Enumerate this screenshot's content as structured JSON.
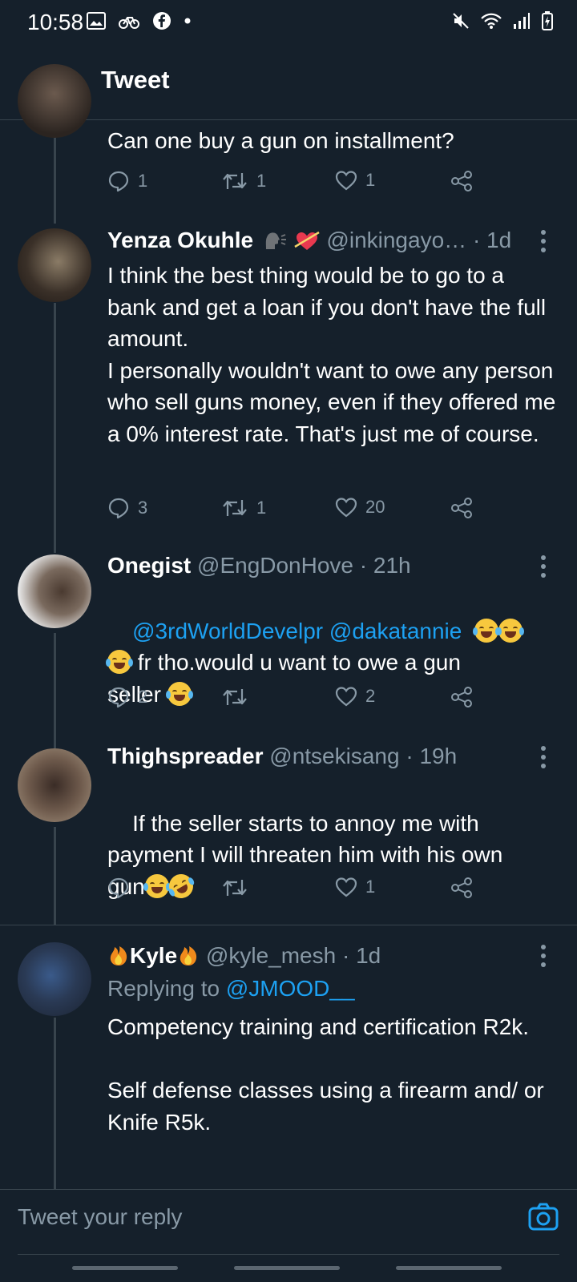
{
  "status_bar": {
    "time": "10:58"
  },
  "header": {
    "title": "Tweet"
  },
  "tweets": [
    {
      "text": "Can one buy a gun on installment?",
      "replies": "1",
      "retweets": "1",
      "likes": "1"
    },
    {
      "name": "Yenza Okuhle",
      "handle": "@inkingayo…",
      "time": "· 1d",
      "text": "I think the best thing would be to go to a bank and get a loan if you don't have the full amount.\nI personally wouldn't want to owe any person who sell guns money, even if they offered me a 0% interest rate. That's just me of course.",
      "replies": "3",
      "retweets": "1",
      "likes": "20"
    },
    {
      "name": "Onegist",
      "handle": "@EngDonHove",
      "time": "· 21h",
      "mention1": "@3rdWorldDevelpr",
      "mention2": "@dakatannie",
      "text_line2": " fr tho.would u want to owe a gun",
      "text_line3": "seller ",
      "replies": "2",
      "retweets": "",
      "likes": "2"
    },
    {
      "name": "Thighspreader",
      "handle": "@ntsekisang",
      "time": "· 19h",
      "text_line1": "If the seller starts to annoy me with",
      "text_line2": "payment I will threaten him with his own",
      "text_line3": "gun",
      "replies": "",
      "retweets": "",
      "likes": "1"
    },
    {
      "name": "Kyle",
      "handle": "@kyle_mesh",
      "time": "· 1d",
      "replying_label": "Replying to",
      "replying_to": "@JMOOD__",
      "text": "Competency training and certification R2k.\n\nSelf defense classes using a firearm and/ or Knife R5k."
    }
  ],
  "reply_bar": {
    "placeholder": "Tweet your reply"
  },
  "colors": {
    "background": "#15202b",
    "accent": "#1da1f2",
    "muted": "#8899a6",
    "divider": "#38444d"
  }
}
